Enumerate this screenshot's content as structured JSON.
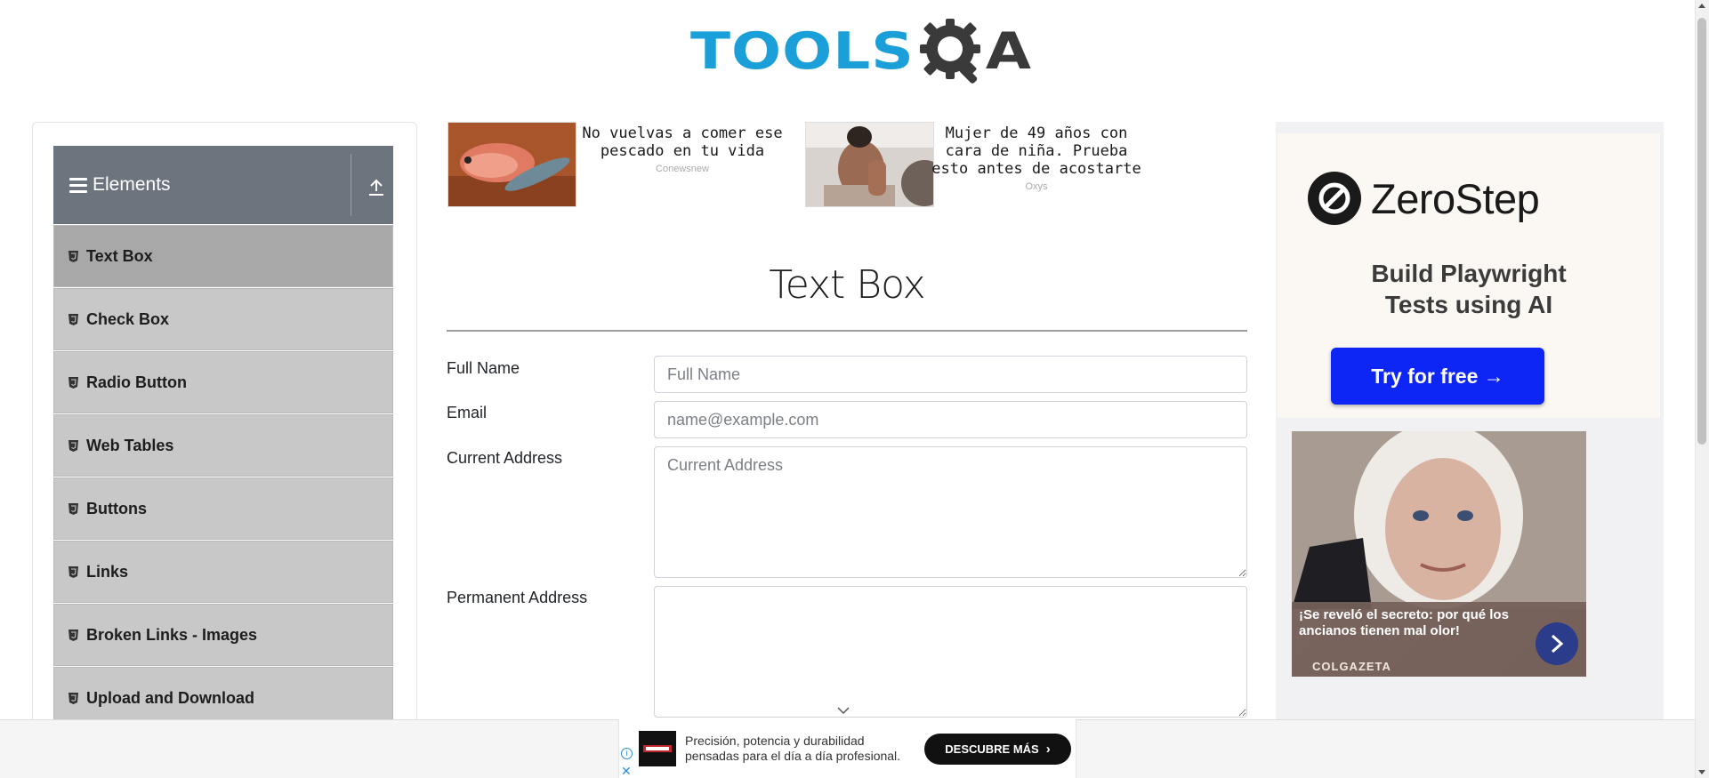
{
  "header": {
    "logo_text_left": "TOOLS",
    "logo_text_right": "A"
  },
  "sidebar": {
    "group_title": "Elements",
    "items": [
      {
        "label": "Text Box",
        "active": true
      },
      {
        "label": "Check Box"
      },
      {
        "label": "Radio Button"
      },
      {
        "label": "Web Tables"
      },
      {
        "label": "Buttons"
      },
      {
        "label": "Links"
      },
      {
        "label": "Broken Links - Images"
      },
      {
        "label": "Upload and Download"
      }
    ]
  },
  "top_ads": [
    {
      "headline": "No vuelvas a comer ese pescado en tu vida",
      "source": "Conewsnew"
    },
    {
      "headline": "Mujer de 49 años con cara de niña. Prueba esto antes de acostarte",
      "source": "Oxys"
    }
  ],
  "main": {
    "title": "Text Box",
    "form": {
      "full_name": {
        "label": "Full Name",
        "placeholder": "Full Name",
        "value": ""
      },
      "email": {
        "label": "Email",
        "placeholder": "name@example.com",
        "value": ""
      },
      "current_address": {
        "label": "Current Address",
        "placeholder": "Current Address",
        "value": ""
      },
      "permanent_address": {
        "label": "Permanent Address",
        "placeholder": "",
        "value": ""
      }
    }
  },
  "right_ad": {
    "brand": "ZeroStep",
    "tagline_line1": "Build Playwright",
    "tagline_line2": "Tests using AI",
    "cta": "Try for free →",
    "story_caption": "¡Se reveló el secreto: por qué los ancianos tienen mal olor!",
    "story_source": "COLGAZETA"
  },
  "bottom_ad": {
    "text": "Precisión, potencia y durabilidad pensadas para el día a día profesional.",
    "cta": "DESCUBRE MÁS"
  },
  "colors": {
    "logo_blue": "#1b9fd8",
    "sidebar_header": "#6c757d",
    "menu_item_bg": "#c8c8c8",
    "menu_item_active": "#a8a8a8",
    "cta_blue": "#0d26f5"
  }
}
